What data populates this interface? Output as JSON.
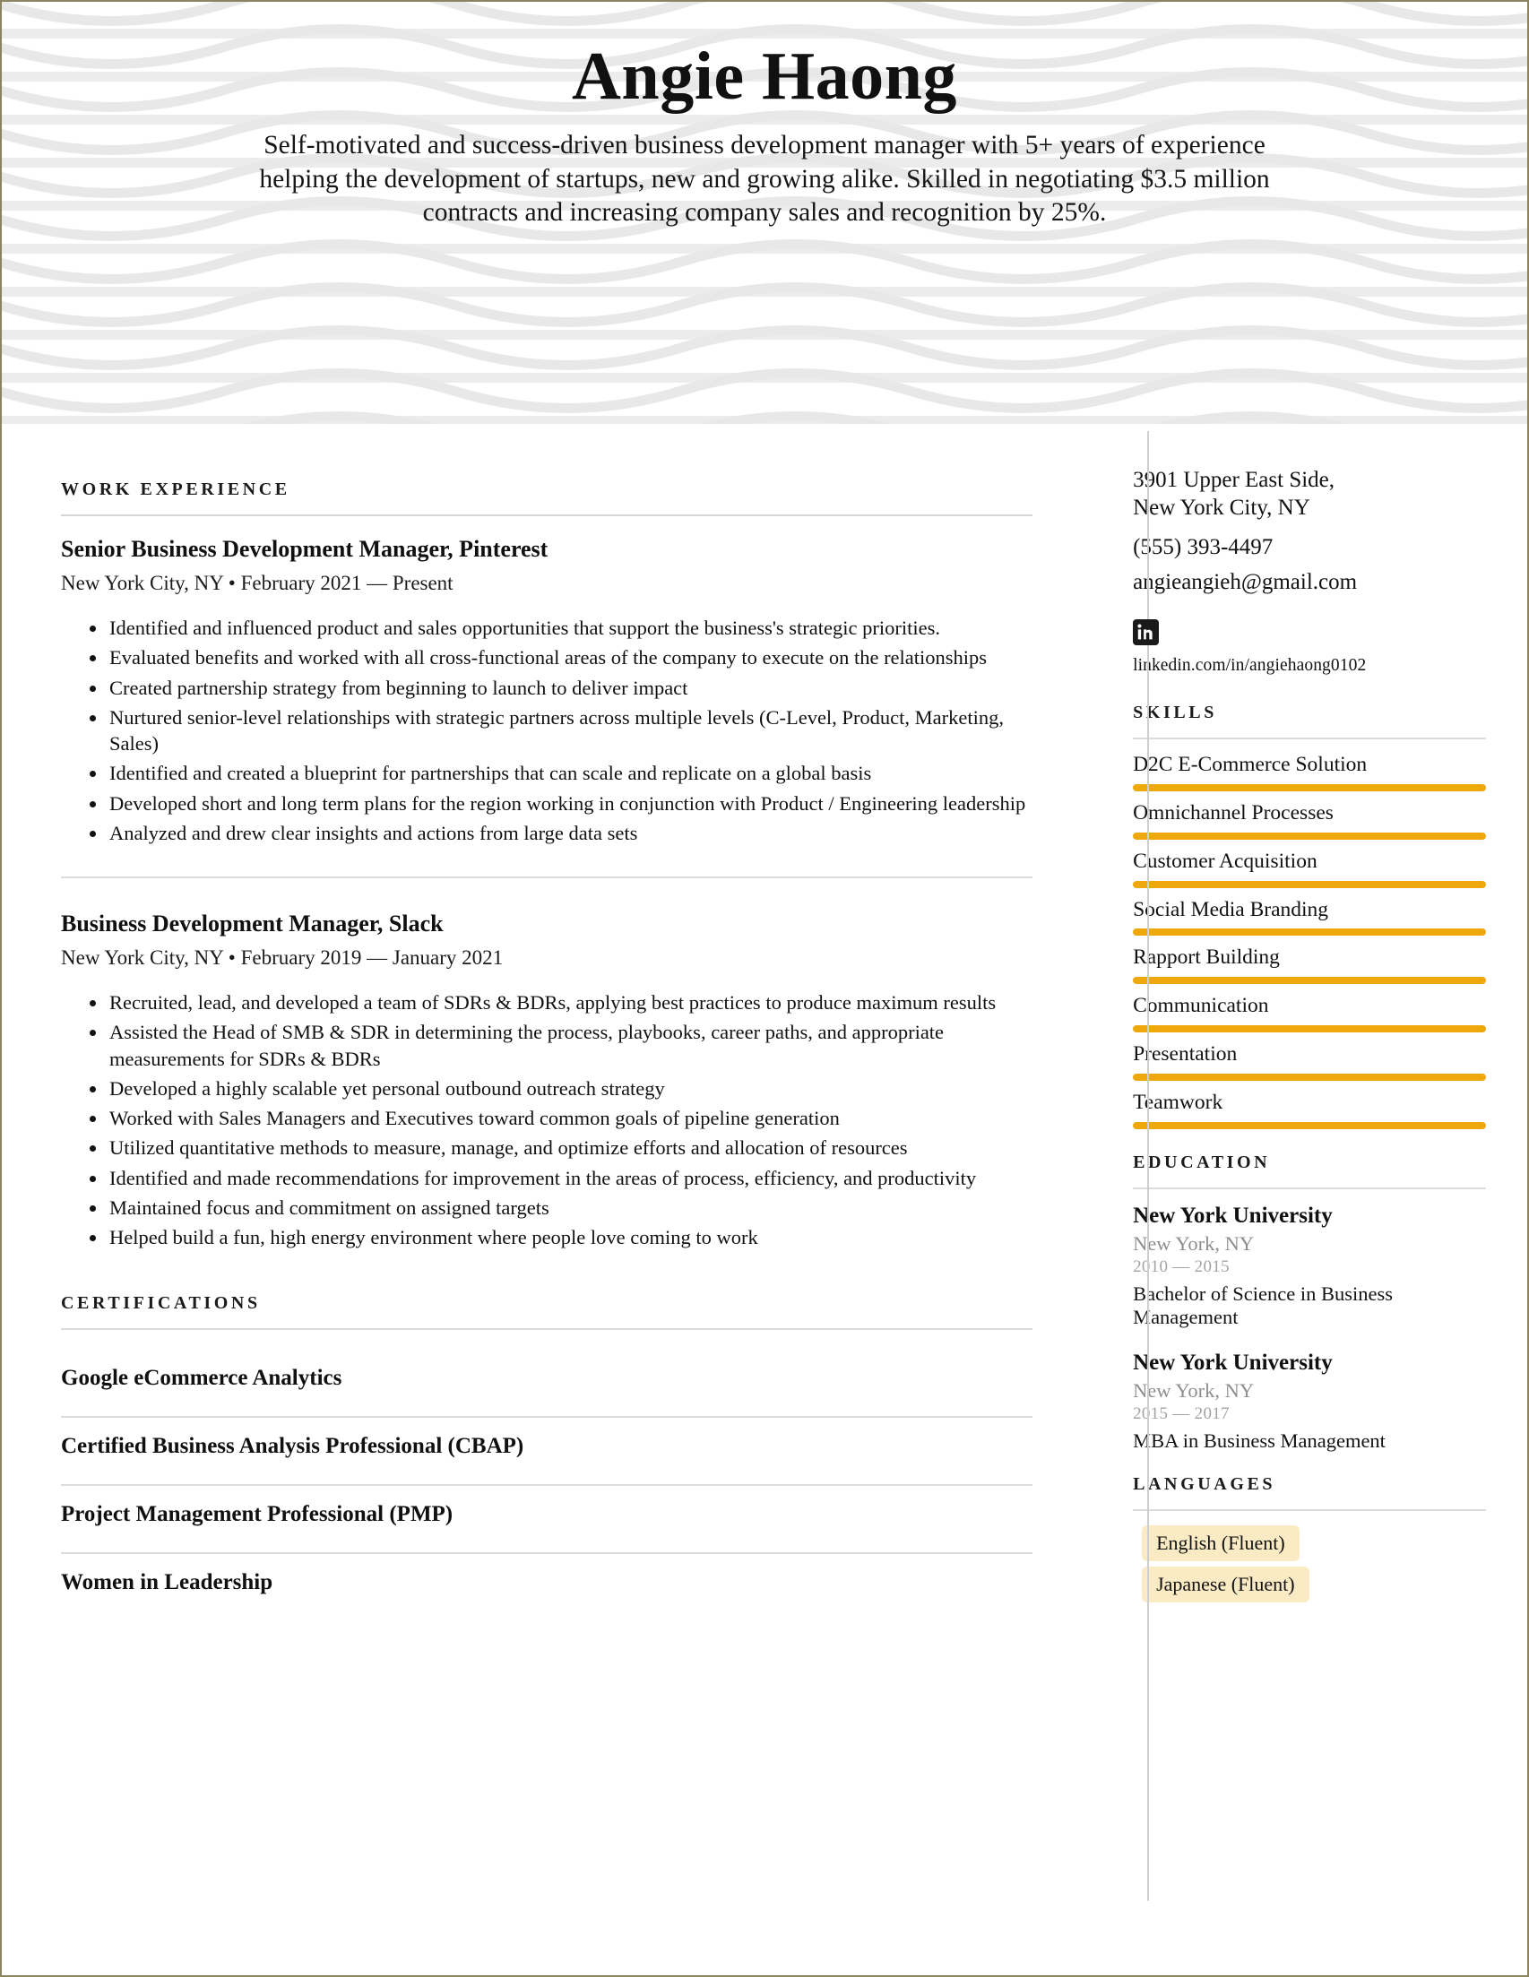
{
  "header": {
    "name": "Angie Haong",
    "summary": "Self-motivated and success-driven business development manager with 5+ years of experience helping the development of startups, new and growing alike. Skilled in negotiating $3.5 million contracts and increasing company sales and recognition by 25%."
  },
  "theme": {
    "accent_bar": "#EFA80B",
    "badge_bg": "#FAEBC4",
    "rule": "#DCDCDC",
    "page_border": "#8A8460",
    "muted_text": "#8E8E8E"
  },
  "left": {
    "work": {
      "title": "Work Experience",
      "jobs": [
        {
          "title": "Senior Business Development Manager, Pinterest",
          "meta": "New York City, NY • February 2021 — Present",
          "bullets": [
            "Identified and influenced product and sales opportunities that support the business's strategic priorities.",
            "Evaluated benefits and worked with all cross-functional areas of the company to execute on the relationships",
            "Created partnership strategy from beginning to launch to deliver impact",
            "Nurtured senior-level relationships with strategic partners across multiple levels (C-Level, Product, Marketing, Sales)",
            "Identified and created a blueprint for partnerships that can scale and replicate on a global basis",
            "Developed short and long term plans for the region working in conjunction with Product / Engineering leadership",
            "Analyzed and drew clear insights and actions from large data sets"
          ]
        },
        {
          "title": "Business Development Manager, Slack",
          "meta": "New York City, NY • February 2019 — January 2021",
          "bullets": [
            "Recruited, lead, and developed a team of SDRs & BDRs, applying best practices to produce maximum results",
            "Assisted the Head of SMB & SDR in determining the process, playbooks, career paths, and appropriate measurements for SDRs & BDRs",
            "Developed a highly scalable yet personal outbound outreach strategy",
            "Worked with Sales Managers and Executives toward common goals of pipeline generation",
            "Utilized quantitative methods to measure, manage, and optimize efforts and allocation of resources",
            "Identified and made recommendations for improvement in the areas of process, efficiency, and productivity",
            "Maintained focus and commitment on assigned targets",
            "Helped build a fun, high energy environment where people love coming to work"
          ]
        }
      ]
    },
    "certifications": {
      "title": "Certifications",
      "items": [
        "Google eCommerce Analytics",
        "Certified Business Analysis Professional (CBAP)",
        "Project Management Professional (PMP)",
        "Women in Leadership"
      ]
    }
  },
  "right": {
    "contact": {
      "address_line1": "3901 Upper East Side,",
      "address_line2": "New York City, NY",
      "phone": "(555) 393-4497",
      "email": "angieangieh@gmail.com",
      "linkedin_icon": "linkedin-icon",
      "linkedin_url": "linkedin.com/in/angiehaong0102"
    },
    "skills": {
      "title": "Skills",
      "items": [
        "D2C E-Commerce Solution",
        "Omnichannel Processes",
        "Customer Acquisition",
        "Social Media Branding",
        "Rapport Building",
        "Communication",
        "Presentation",
        "Teamwork"
      ]
    },
    "education": {
      "title": "Education",
      "items": [
        {
          "school": "New York University",
          "location": "New York, NY",
          "dates": "2010 — 2015",
          "degree": "Bachelor of Science in Business Management"
        },
        {
          "school": "New York University",
          "location": "New York, NY",
          "dates": "2015 — 2017",
          "degree": "MBA in Business Management"
        }
      ]
    },
    "languages": {
      "title": "Languages",
      "items": [
        "English (Fluent)",
        "Japanese (Fluent)"
      ]
    }
  }
}
